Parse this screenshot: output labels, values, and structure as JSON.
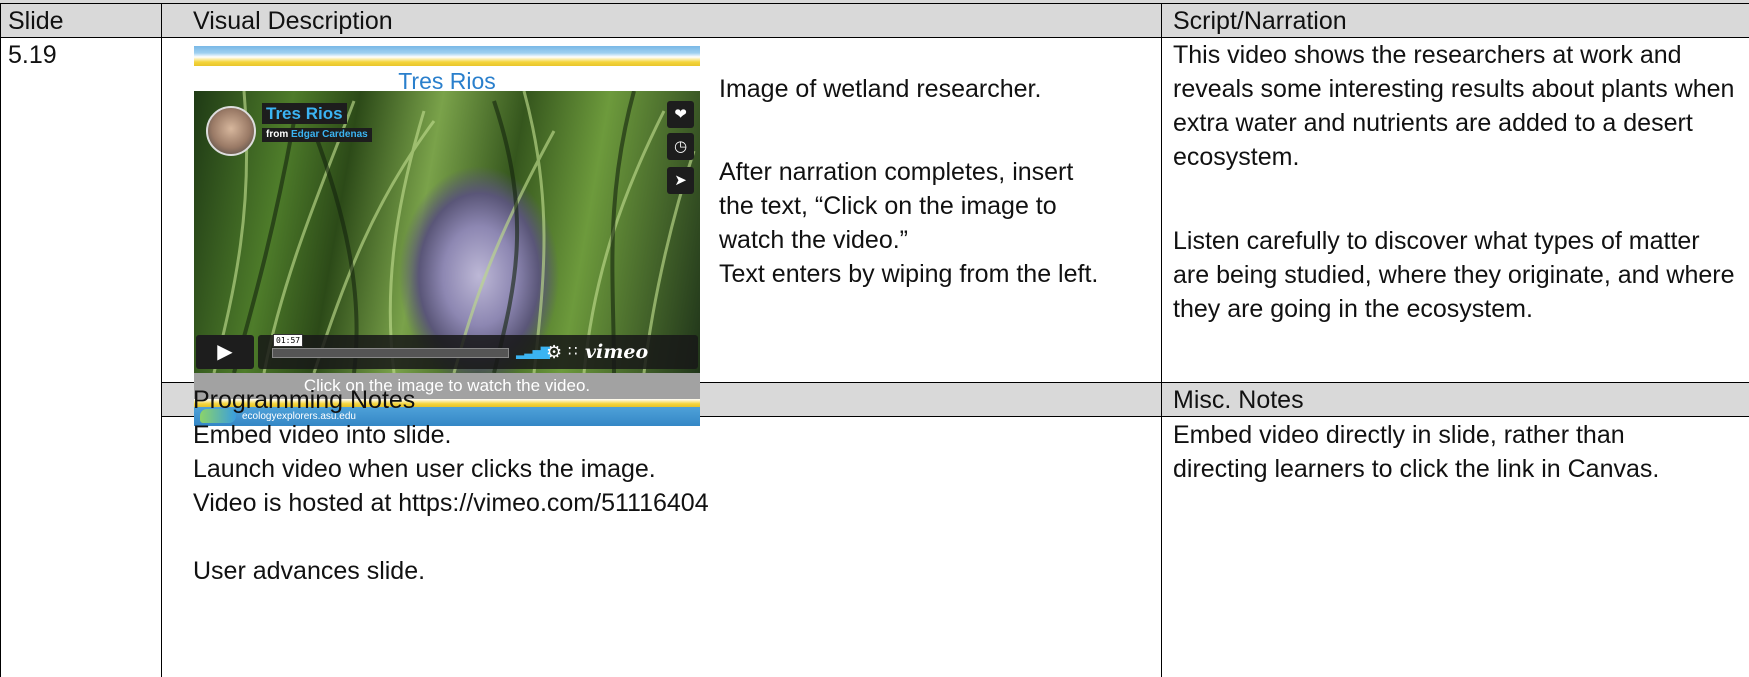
{
  "table": {
    "headers": {
      "slide": "Slide",
      "visual": "Visual Description",
      "script": "Script/Narration",
      "programming": "Programming Notes",
      "misc": "Misc. Notes"
    },
    "slide_number": "5.19",
    "visual_description": {
      "line1": "Image of wetland researcher.",
      "line2": "After narration completes, insert",
      "line3": "the text, “Click on the image to",
      "line4": "watch the video.”",
      "line5": " Text enters by wiping from the left."
    },
    "script_narration": {
      "paragraph1": "This video shows the researchers at work and reveals some interesting results about plants when extra water and nutrients are added to a desert ecosystem.",
      "paragraph2": "Listen carefully to discover what types of matter are being studied, where they originate, and where they are going in the ecosystem."
    },
    "programming_notes": {
      "line1": "Embed video into slide.",
      "line2": "Launch video when user clicks the image.",
      "line3": "Video is hosted at https://vimeo.com/51116404",
      "line4": "User advances slide."
    },
    "misc_notes": "Embed video directly in slide, rather than directing learners to click the link in Canvas."
  },
  "slide_thumbnail": {
    "title": "Tres Rios",
    "video": {
      "title": "Tres Rios",
      "from_label": "from",
      "author": "Edgar Cardenas",
      "timestamp": "01:57",
      "brand": "vimeo",
      "icons": [
        "heart-icon",
        "clock-icon",
        "send-icon",
        "play-icon",
        "volume-icon",
        "gear-icon",
        "fullscreen-icon"
      ]
    },
    "caption": "Click on the image to watch the video.",
    "site": "ecologyexplorers.asu.edu",
    "colors": {
      "title": "#2a7fcc",
      "accent": "#3bb4f2",
      "caption_bg": "#a2a2a2",
      "band_blue": "#3487c6",
      "band_yellow": "#f4d53c"
    }
  }
}
